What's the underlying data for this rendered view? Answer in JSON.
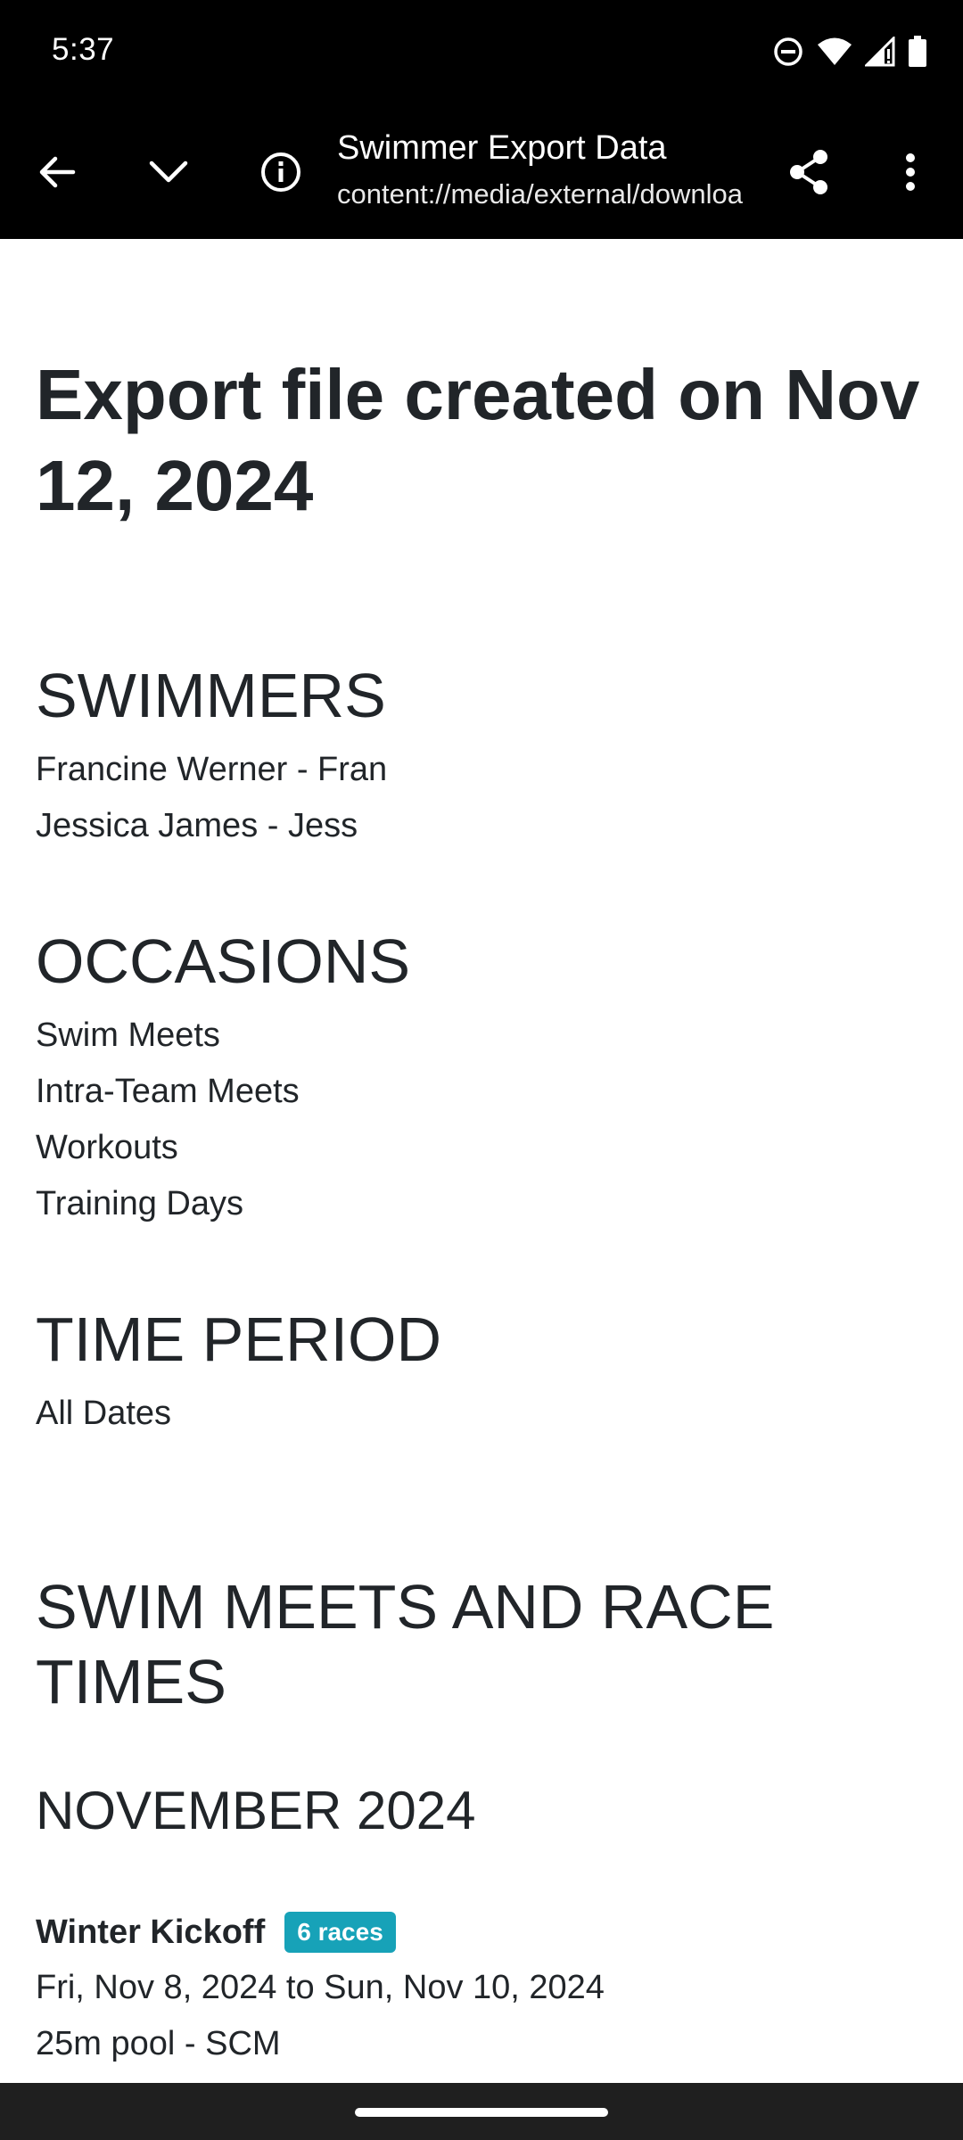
{
  "status_bar": {
    "time": "5:37",
    "icons": [
      "do-not-disturb-icon",
      "wifi-icon",
      "signal-icon",
      "battery-icon"
    ]
  },
  "toolbar": {
    "title": "Swimmer Export Data",
    "url": "content://media/external/downloa",
    "icons": [
      "back-arrow-icon",
      "chevron-down-icon",
      "info-icon",
      "share-icon",
      "more-vert-icon"
    ]
  },
  "document": {
    "heading": "Export file created on Nov 12, 2024",
    "swimmers": {
      "title": "SWIMMERS",
      "items": [
        "Francine Werner - Fran",
        "Jessica James - Jess"
      ]
    },
    "occasions": {
      "title": "OCCASIONS",
      "items": [
        "Swim Meets",
        "Intra-Team Meets",
        "Workouts",
        "Training Days"
      ]
    },
    "time_period": {
      "title": "TIME PERIOD",
      "items": [
        "All Dates"
      ]
    },
    "meets_section": {
      "title": "SWIM MEETS AND RACE TIMES",
      "month": "NOVEMBER 2024",
      "meets": [
        {
          "name": "Winter Kickoff",
          "badge": "6 races",
          "dates": "Fri, Nov 8, 2024 to Sun, Nov 10, 2024",
          "pool": "25m pool - SCM"
        }
      ]
    }
  },
  "colors": {
    "bar_background": "#000000",
    "text": "#212529",
    "badge": "#17a2b8",
    "nav_bar": "#1f1f1f"
  }
}
